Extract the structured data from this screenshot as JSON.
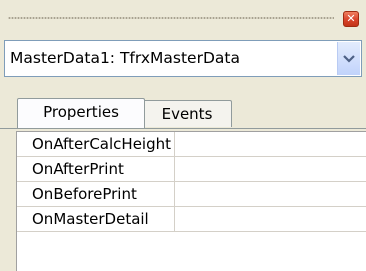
{
  "object_selector": {
    "value": "MasterData1: TfrxMasterData"
  },
  "tabs": [
    {
      "label": "Properties",
      "active": true
    },
    {
      "label": "Events",
      "active": false
    }
  ],
  "events": [
    {
      "name": "OnAfterCalcHeight",
      "value": ""
    },
    {
      "name": "OnAfterPrint",
      "value": ""
    },
    {
      "name": "OnBeforePrint",
      "value": ""
    },
    {
      "name": "OnMasterDetail",
      "value": ""
    }
  ],
  "colors": {
    "panel": "#ece9d8",
    "close": "#d8432a",
    "combo_border": "#7f9db9"
  },
  "icons": [
    "drag-grip-icon",
    "close-icon",
    "chevron-down-icon"
  ]
}
